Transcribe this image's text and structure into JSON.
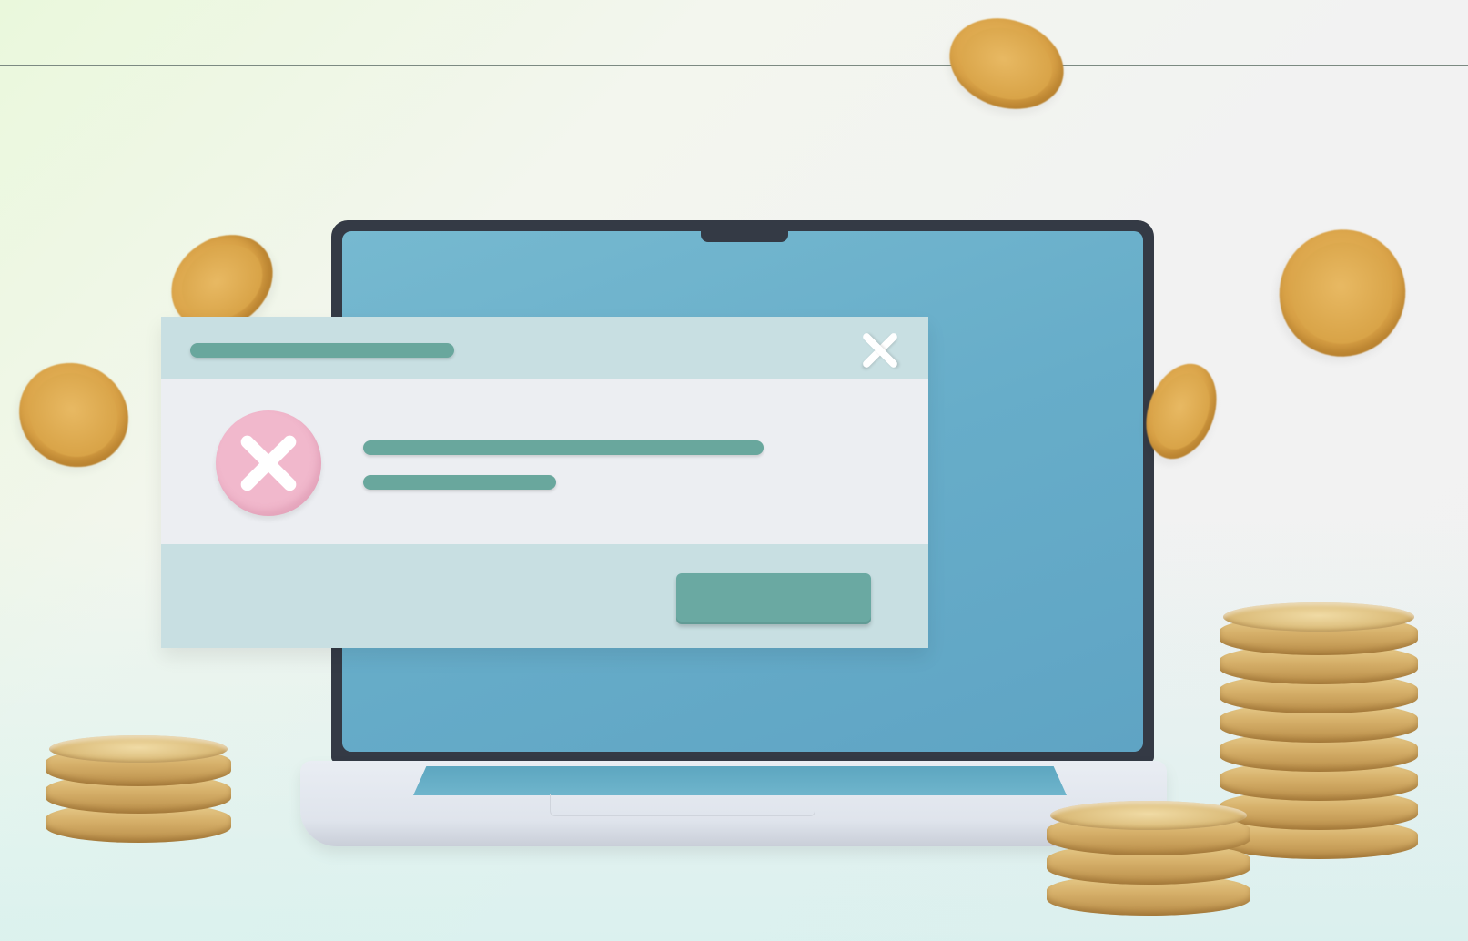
{
  "scene": {
    "subject": "laptop-with-error-dialog",
    "colors": {
      "screen": "#67adc9",
      "dialog_frame": "#c8dfe2",
      "dialog_body": "#eceef2",
      "placeholder_bar": "#69a79d",
      "error_icon": "#f1b8cc",
      "coin": "#d9a247"
    },
    "icons": {
      "dialog_close": "close-icon",
      "error": "error-x-icon"
    }
  }
}
